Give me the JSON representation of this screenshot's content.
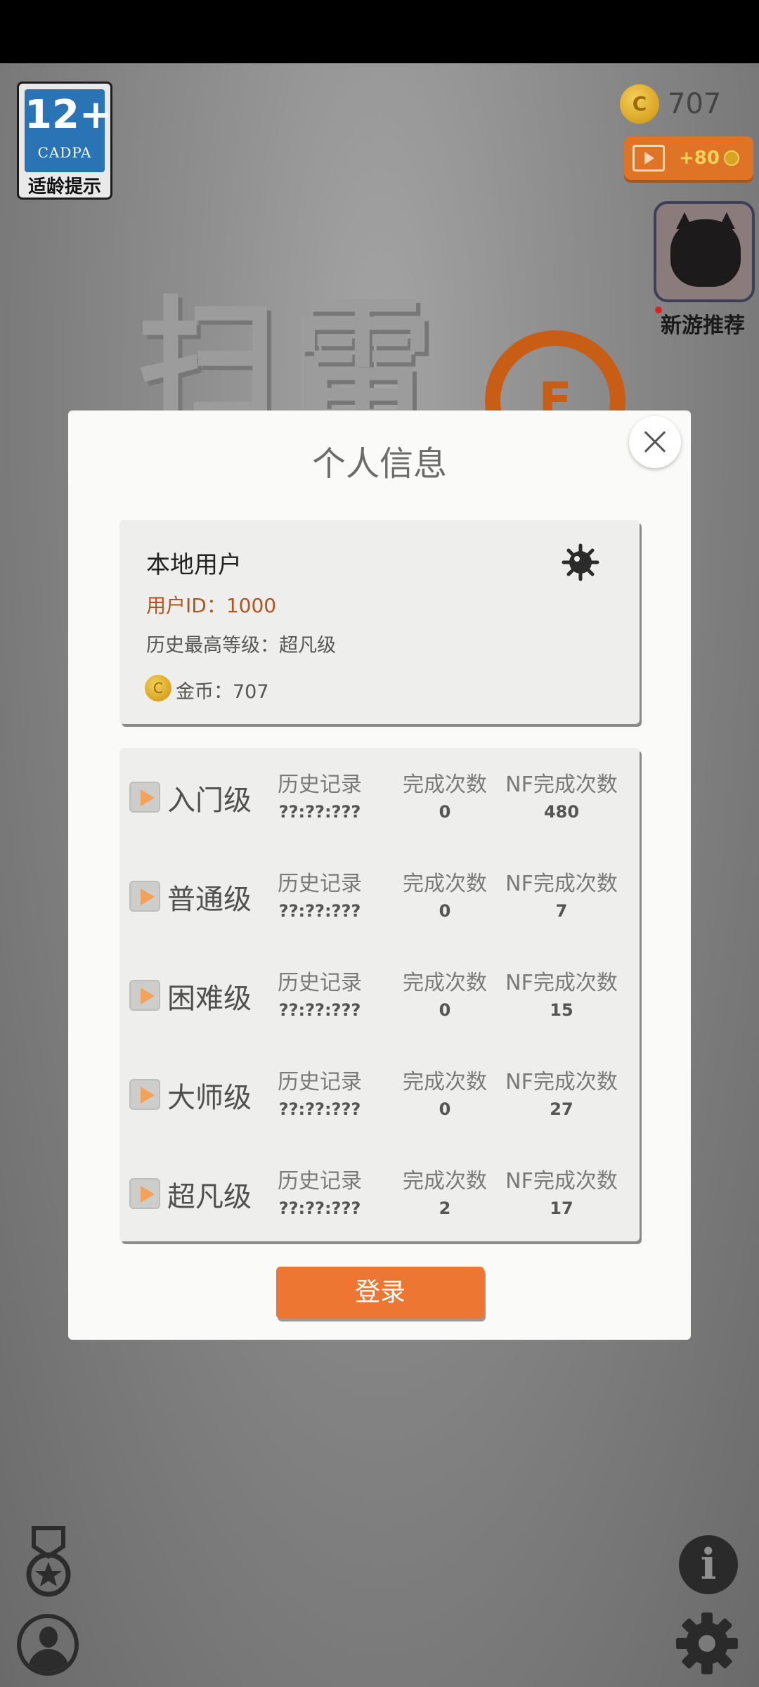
{
  "age_badge": {
    "number": "12+",
    "org": "CADPA",
    "tip": "适龄提示"
  },
  "top": {
    "coins": "707",
    "video_reward": "+80",
    "recommend_label": "新游推荐"
  },
  "background_title": {
    "text": "扫雷",
    "bomb_letter": "F"
  },
  "modal": {
    "title": "个人信息",
    "user": {
      "name": "本地用户",
      "id": "用户ID：1000",
      "best_level": "历史最高等级：超凡级",
      "coins": "金币：707",
      "coin_glyph": "C"
    },
    "columns": {
      "history": "历史记录",
      "completions": "完成次数",
      "nf_completions": "NF完成次数"
    },
    "levels": [
      {
        "name": "入门级",
        "history": "??:??:???",
        "completions": "0",
        "nf_completions": "480"
      },
      {
        "name": "普通级",
        "history": "??:??:???",
        "completions": "0",
        "nf_completions": "7"
      },
      {
        "name": "困难级",
        "history": "??:??:???",
        "completions": "0",
        "nf_completions": "15"
      },
      {
        "name": "大师级",
        "history": "??:??:???",
        "completions": "0",
        "nf_completions": "27"
      },
      {
        "name": "超凡级",
        "history": "??:??:???",
        "completions": "2",
        "nf_completions": "17"
      }
    ],
    "login_label": "登录"
  },
  "icons": {
    "close": "close-icon",
    "mine": "mine-icon",
    "medal": "medal-icon",
    "profile": "profile-icon",
    "info": "info-icon",
    "settings": "gear-icon",
    "play": "play-icon",
    "video": "video-icon",
    "coin": "coin-icon"
  },
  "colors": {
    "accent_orange": "#ec7632",
    "user_id_text": "#b0551d",
    "coin_gold": "#d9a423",
    "badge_blue": "#2a73b5"
  }
}
